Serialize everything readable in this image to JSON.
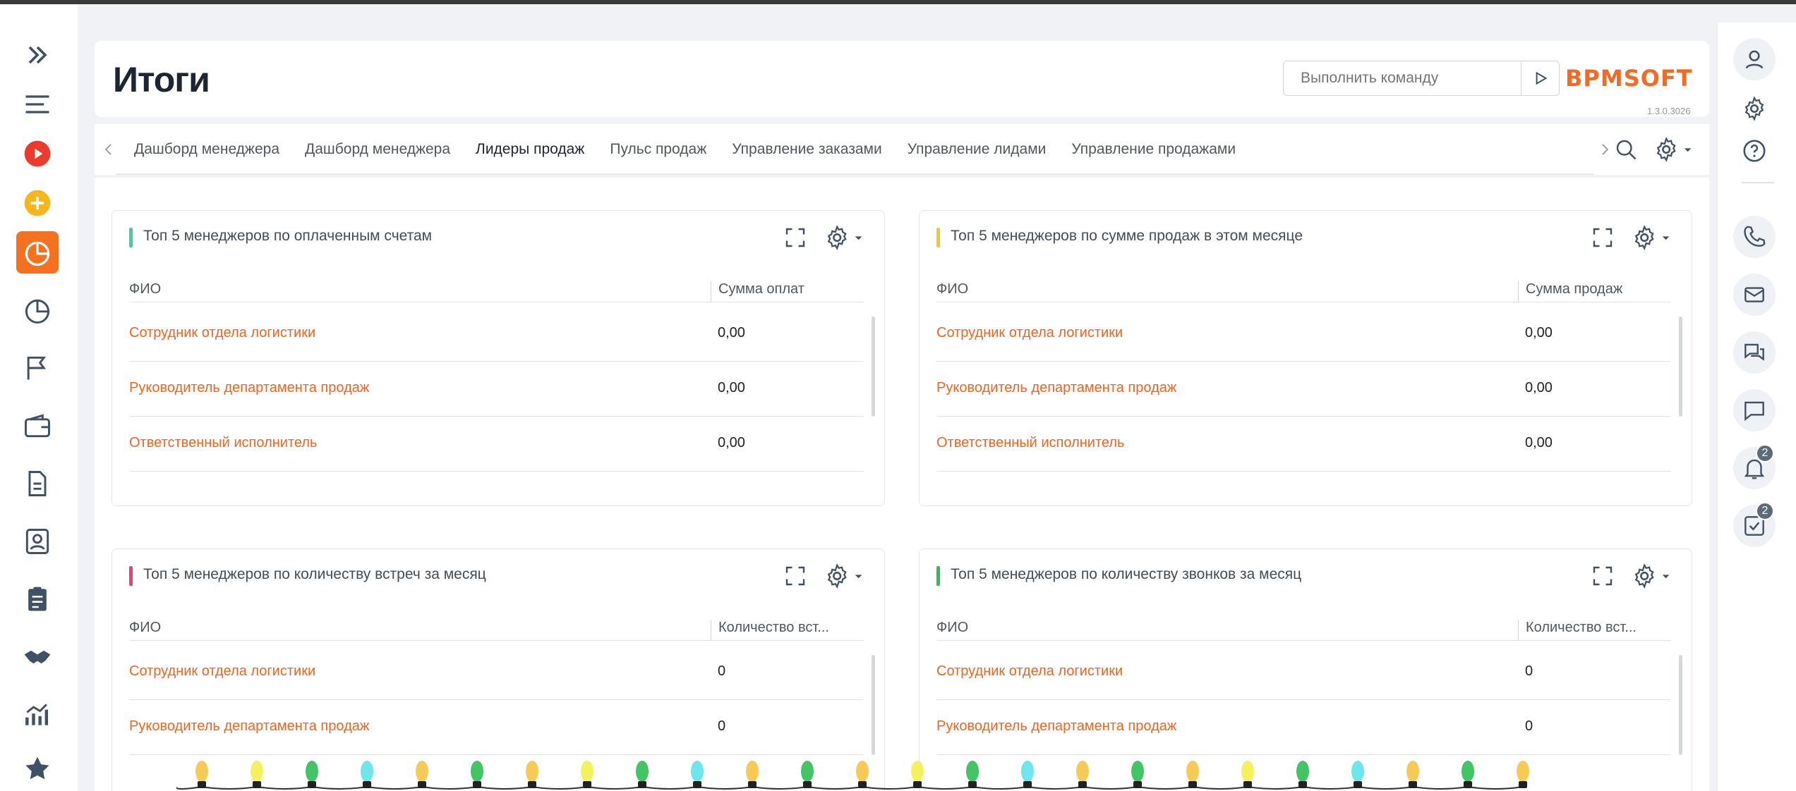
{
  "page": {
    "title": "Итоги"
  },
  "header": {
    "command_placeholder": "Выполнить команду",
    "logo": "BPMSOFT",
    "version": "1.3.0.3026"
  },
  "nav": {
    "items": [
      {
        "icon": "expand-icon"
      },
      {
        "icon": "menu-icon"
      },
      {
        "icon": "play-icon"
      },
      {
        "icon": "add-icon"
      },
      {
        "icon": "dashboard-icon",
        "active": true
      },
      {
        "icon": "pie-chart-icon"
      },
      {
        "icon": "flag-icon"
      },
      {
        "icon": "wallet-icon"
      },
      {
        "icon": "document-icon"
      },
      {
        "icon": "contact-icon"
      },
      {
        "icon": "clipboard-icon"
      },
      {
        "icon": "handshake-icon"
      },
      {
        "icon": "analytics-icon"
      },
      {
        "icon": "star-icon"
      }
    ]
  },
  "rightbar": {
    "notifications_count": "2",
    "tasks_count": "2"
  },
  "tabs": [
    {
      "label": "Дашборд менеджера"
    },
    {
      "label": "Дашборд менеджера"
    },
    {
      "label": "Лидеры продаж",
      "active": true
    },
    {
      "label": "Пульс продаж"
    },
    {
      "label": "Управление заказами"
    },
    {
      "label": "Управление лидами"
    },
    {
      "label": "Управление продажами"
    }
  ],
  "widgets": [
    {
      "title": "Топ 5 менеджеров по оплаченным счетам",
      "accent": "#3fcf9a",
      "col1": "ФИО",
      "col2": "Сумма оплат",
      "rows": [
        {
          "name": "Сотрудник отдела логистики",
          "value": "0,00"
        },
        {
          "name": "Руководитель департамента продаж",
          "value": "0,00"
        },
        {
          "name": "Ответственный исполнитель",
          "value": "0,00"
        }
      ]
    },
    {
      "title": "Топ 5 менеджеров по сумме продаж в этом месяце",
      "accent": "#f2c832",
      "col1": "ФИО",
      "col2": "Сумма продаж",
      "rows": [
        {
          "name": "Сотрудник отдела логистики",
          "value": "0,00"
        },
        {
          "name": "Руководитель департамента продаж",
          "value": "0,00"
        },
        {
          "name": "Ответственный исполнитель",
          "value": "0,00"
        }
      ]
    },
    {
      "title": "Топ 5 менеджеров по количеству встреч за месяц",
      "accent": "#e8407a",
      "col1": "ФИО",
      "col2": "Количество вст...",
      "rows": [
        {
          "name": "Сотрудник отдела логистики",
          "value": "0"
        },
        {
          "name": "Руководитель департамента продаж",
          "value": "0"
        }
      ]
    },
    {
      "title": "Топ 5 менеджеров по количеству звонков за месяц",
      "accent": "#34b858",
      "col1": "ФИО",
      "col2": "Количество вст...",
      "rows": [
        {
          "name": "Сотрудник отдела логистики",
          "value": "0"
        },
        {
          "name": "Руководитель департамента продаж",
          "value": "0"
        }
      ]
    }
  ]
}
